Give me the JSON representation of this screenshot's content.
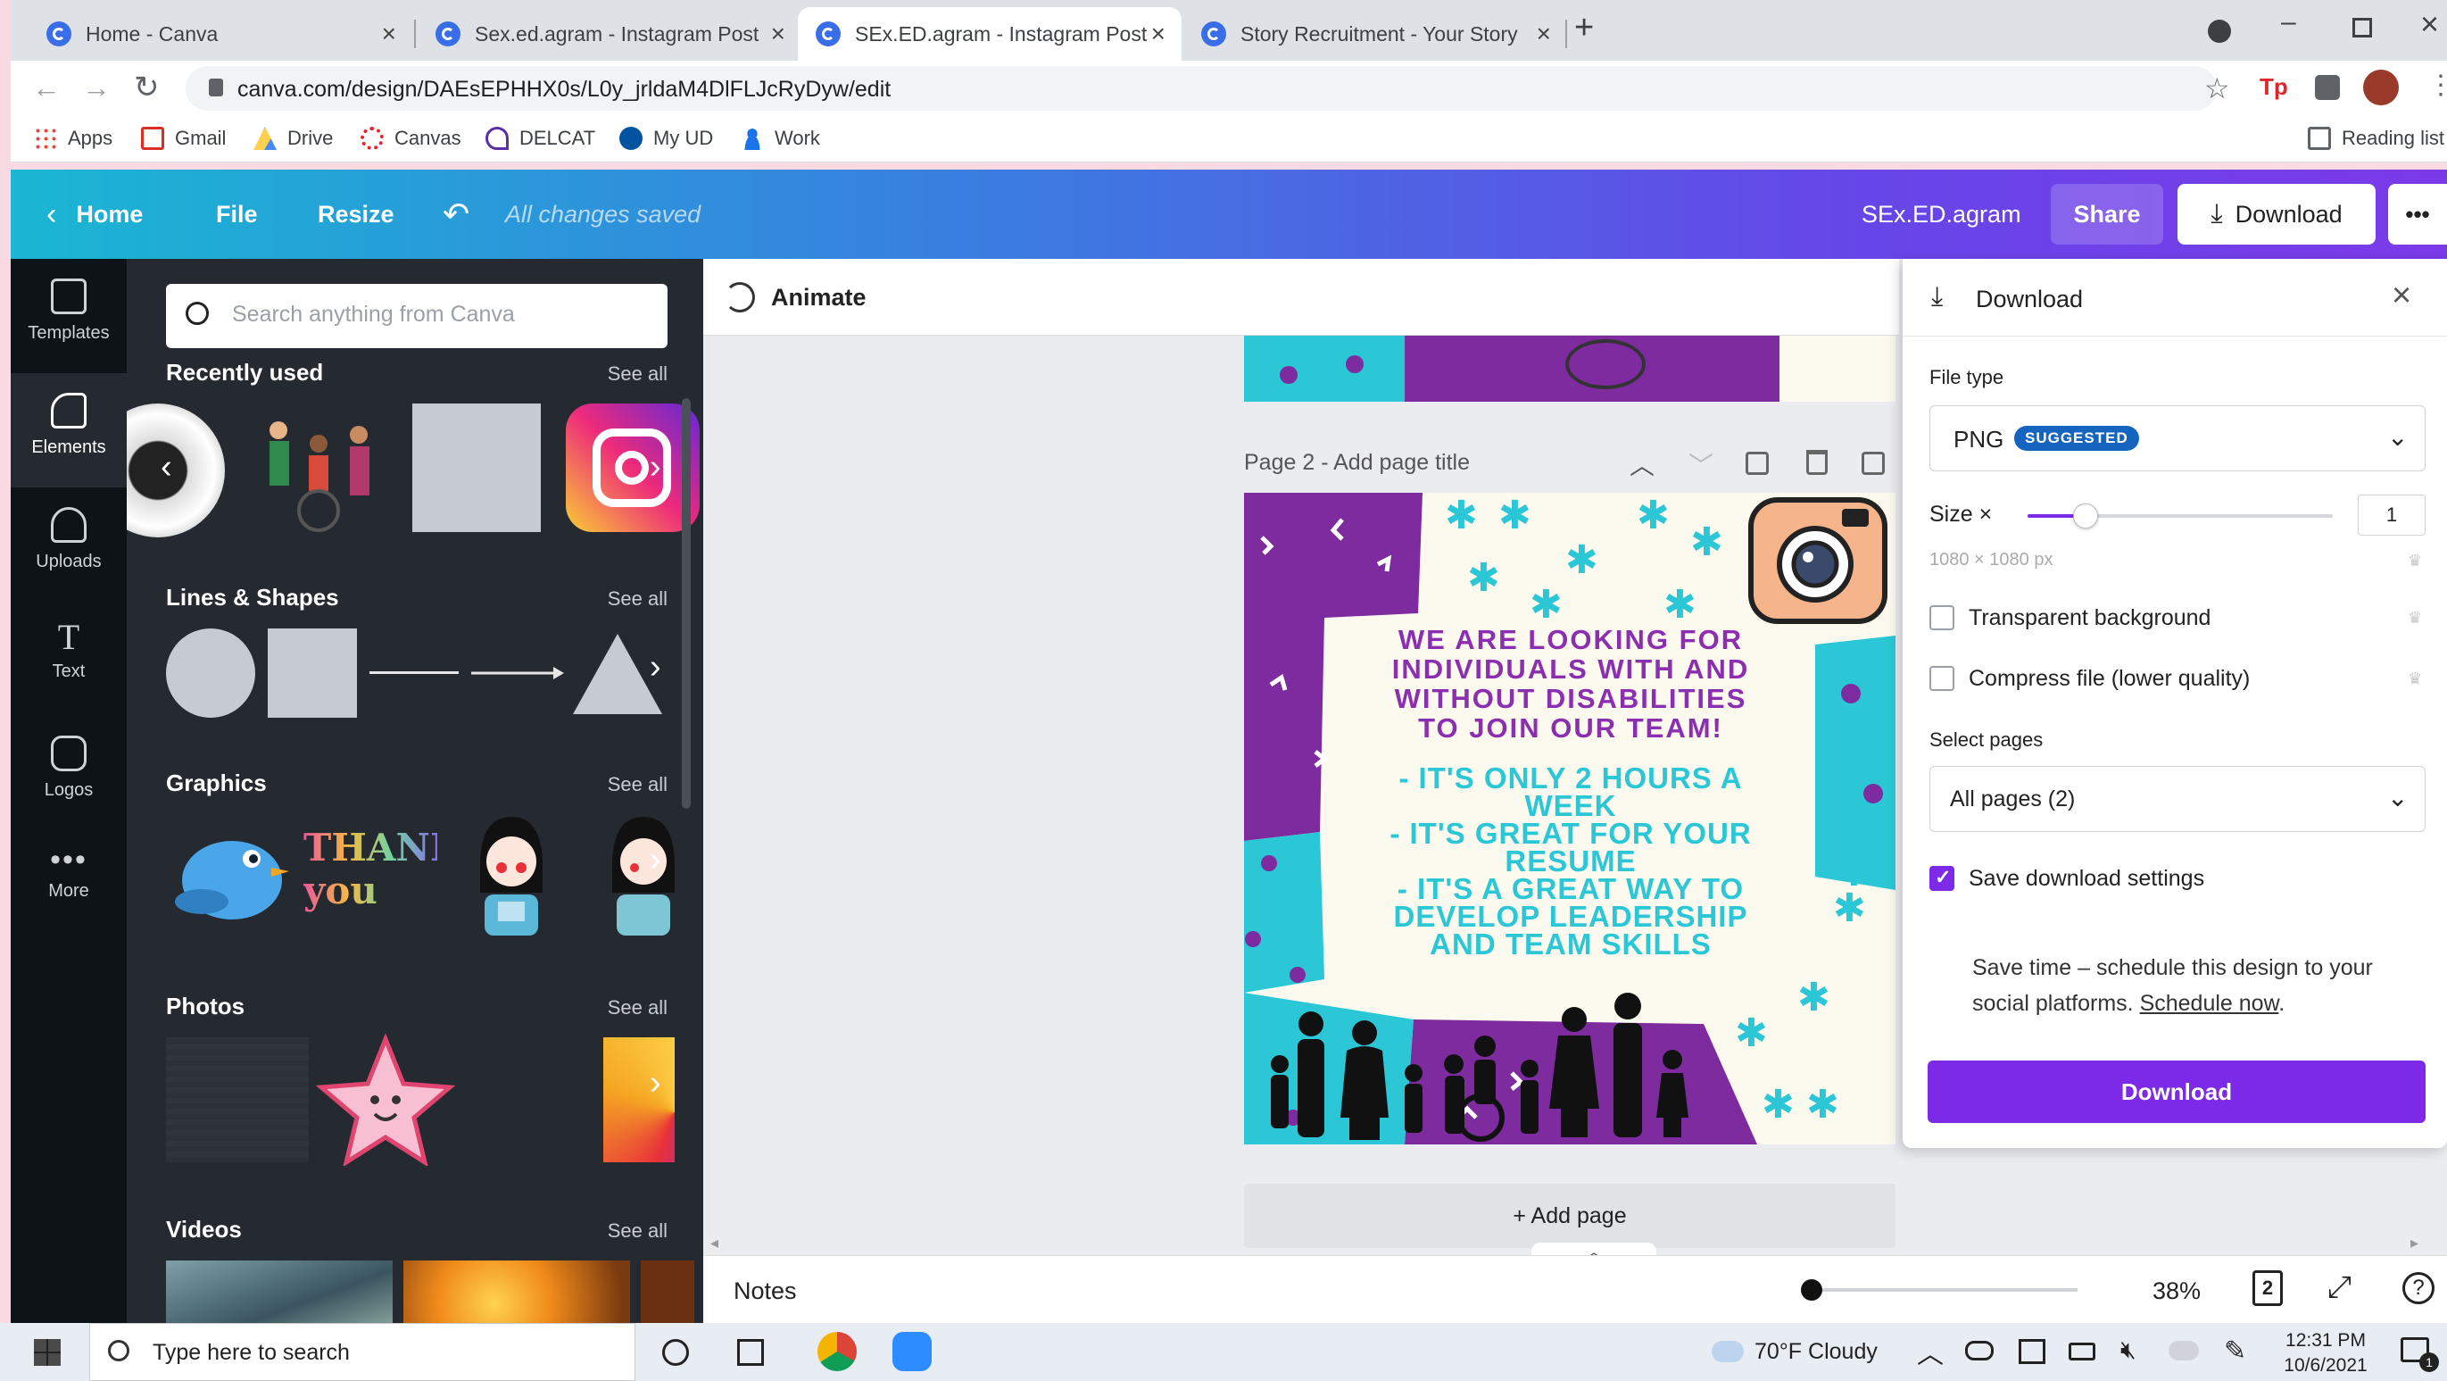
{
  "browser": {
    "tabs": [
      {
        "title": "Home - Canva",
        "active": false
      },
      {
        "title": "Sex.ed.agram - Instagram Post",
        "active": false
      },
      {
        "title": "SEx.ED.agram - Instagram Post",
        "active": true
      },
      {
        "title": "Story Recruitment - Your Story",
        "active": false
      }
    ],
    "new_tab_label": "+",
    "url": "canva.com/design/DAEsEPHHX0s/L0y_jrldaM4DlFLJcRyDyw/edit",
    "bookmarks": [
      "Apps",
      "Gmail",
      "Drive",
      "Canvas",
      "DELCAT",
      "My UD",
      "Work"
    ],
    "reading_list": "Reading list"
  },
  "header": {
    "home": "Home",
    "file": "File",
    "resize": "Resize",
    "saved_status": "All changes saved",
    "design_title": "SEx.ED.agram",
    "share": "Share",
    "download": "Download",
    "more": "•••"
  },
  "rail": {
    "items": [
      {
        "label": "Templates",
        "icon": "templates-icon"
      },
      {
        "label": "Elements",
        "icon": "elements-icon",
        "active": true
      },
      {
        "label": "Uploads",
        "icon": "upload-cloud-icon"
      },
      {
        "label": "Text",
        "icon": "text-icon"
      },
      {
        "label": "Logos",
        "icon": "logo-icon"
      },
      {
        "label": "More",
        "icon": "more-dots-icon"
      }
    ]
  },
  "panel": {
    "search_placeholder": "Search anything from Canva",
    "sections": [
      {
        "title": "Recently used",
        "see_all": "See all"
      },
      {
        "title": "Lines & Shapes",
        "see_all": "See all"
      },
      {
        "title": "Graphics",
        "see_all": "See all"
      },
      {
        "title": "Photos",
        "see_all": "See all"
      },
      {
        "title": "Videos",
        "see_all": "See all"
      }
    ],
    "graphic_text": "THANK you"
  },
  "editor": {
    "animate": "Animate",
    "page_label": "Page 2",
    "page_title_placeholder": "Add page title",
    "add_page": "+ Add page",
    "notes": "Notes",
    "zoom": "38%",
    "page_count": "2",
    "help": "?"
  },
  "design": {
    "headline": [
      "WE ARE LOOKING FOR",
      "INDIVIDUALS WITH AND",
      "WITHOUT DISABILITIES",
      "TO JOIN OUR TEAM!"
    ],
    "bullets": [
      "- IT'S ONLY 2 HOURS A",
      "WEEK",
      "- IT'S GREAT FOR YOUR",
      "RESUME",
      "- IT'S A GREAT WAY TO",
      "DEVELOP LEADERSHIP",
      "AND TEAM SKILLS"
    ],
    "colors": {
      "purple": "#7d2b9e",
      "teal": "#2bc7d6",
      "cream": "#fcf9ef",
      "text": "#8b2fb0"
    }
  },
  "download_panel": {
    "title": "Download",
    "file_type_label": "File type",
    "file_type_value": "PNG",
    "suggested_badge": "SUGGESTED",
    "size_label": "Size ×",
    "size_value": "1",
    "size_fraction": 0.19,
    "dimensions": "1080 × 1080 px",
    "transparent_bg": "Transparent background",
    "compress": "Compress file (lower quality)",
    "select_pages_label": "Select pages",
    "pages_value": "All pages (2)",
    "save_settings": "Save download settings",
    "schedule_text": "Save time – schedule this design to your social platforms.",
    "schedule_link": "Schedule now",
    "schedule_end": ".",
    "download_button": "Download",
    "accent": "#7d2ae8"
  },
  "taskbar": {
    "search_placeholder": "Type here to search",
    "weather": "70°F  Cloudy",
    "time": "12:31 PM",
    "date": "10/6/2021",
    "notification_count": "1"
  }
}
